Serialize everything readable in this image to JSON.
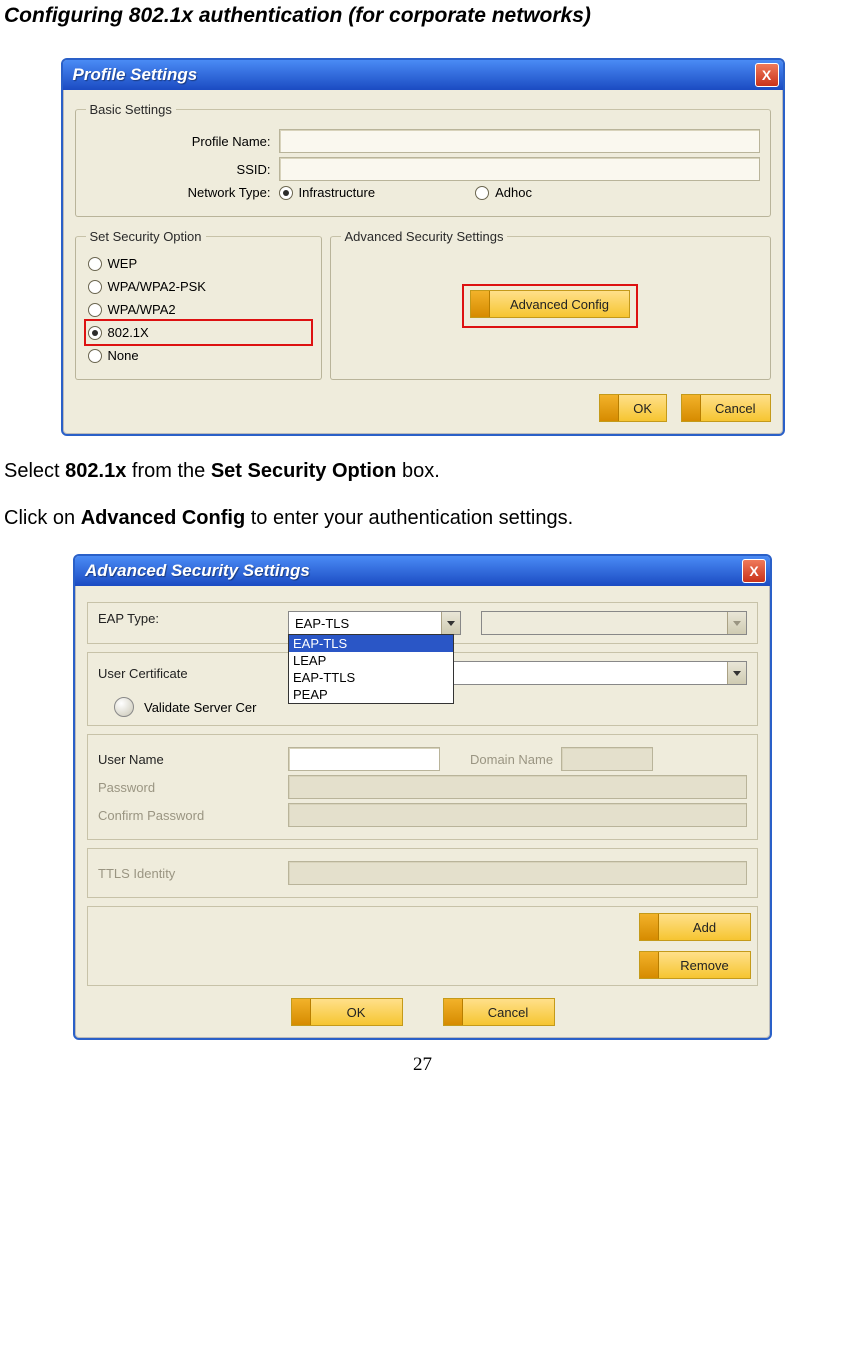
{
  "heading": "Configuring 802.1x authentication (for corporate networks)",
  "instruction1_pre": "Select ",
  "instruction1_b1": "802.1x",
  "instruction1_mid": " from the ",
  "instruction1_b2": "Set Security Option",
  "instruction1_post": " box.",
  "instruction2_pre": "Click on ",
  "instruction2_b1": "Advanced Config",
  "instruction2_post": " to enter your authentication settings.",
  "page_number": "27",
  "profile": {
    "title": "Profile Settings",
    "close": "X",
    "basic_legend": "Basic Settings",
    "profile_name_label": "Profile Name:",
    "ssid_label": "SSID:",
    "network_type_label": "Network Type:",
    "network_type_infra": "Infrastructure",
    "network_type_adhoc": "Adhoc",
    "security_legend": "Set Security Option",
    "sec_wep": "WEP",
    "sec_wpapsk": "WPA/WPA2-PSK",
    "sec_wpa": "WPA/WPA2",
    "sec_8021x": "802.1X",
    "sec_none": "None",
    "adv_legend": "Advanced Security Settings",
    "adv_btn": "Advanced Config",
    "ok": "OK",
    "cancel": "Cancel"
  },
  "advanced": {
    "title": "Advanced Security Settings",
    "close": "X",
    "eap_type_label": "EAP Type:",
    "eap_selected": "EAP-TLS",
    "eap_options": {
      "o1": "EAP-TLS",
      "o2": "LEAP",
      "o3": "EAP-TTLS",
      "o4": "PEAP"
    },
    "user_cert_label": "User Certificate",
    "validate_label": "Validate Server Cer",
    "user_name_label": "User Name",
    "domain_name_label": "Domain Name",
    "password_label": "Password",
    "confirm_password_label": "Confirm Password",
    "ttls_label": "TTLS Identity",
    "add": "Add",
    "remove": "Remove",
    "ok": "OK",
    "cancel": "Cancel"
  }
}
